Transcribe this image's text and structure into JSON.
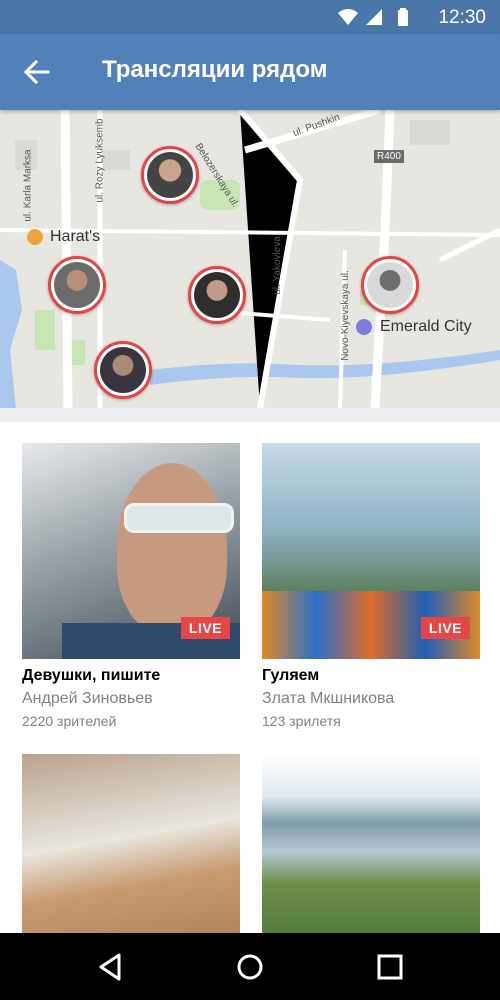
{
  "status_bar": {
    "time": "12:30"
  },
  "app_bar": {
    "title": "Трансляции рядом",
    "back_icon": "arrow-left-icon"
  },
  "map": {
    "streets": [
      "ul. Pushkin",
      "Belozerskaya ul.",
      "ul. Karla Marksa",
      "ul. Rozy Lyuksemb",
      "ul. Yakovleva",
      "Novo-Kiyevskaya ul.",
      "R400"
    ],
    "places": [
      {
        "name": "Harat's",
        "icon": "restaurant-icon",
        "color": "#f0a43c"
      },
      {
        "name": "Emerald City",
        "icon": "shopping-icon",
        "color": "#7b7ce0"
      }
    ]
  },
  "streams": [
    {
      "title": "Девушки, пишите",
      "author": "Андрей Зиновьев",
      "viewers": "2220 зрителей",
      "badge": "LIVE"
    },
    {
      "title": "Гуляем",
      "author": "Злата Мкшникова",
      "viewers": "123 зрилетя",
      "badge": "LIVE"
    },
    {
      "title": "",
      "author": "",
      "viewers": "",
      "badge": ""
    },
    {
      "title": "",
      "author": "",
      "viewers": "",
      "badge": ""
    }
  ],
  "colors": {
    "header": "#5181b8",
    "statusbar": "#4a76a8",
    "live": "#e64646",
    "marker_ring": "#e24545"
  },
  "nav": {
    "back": "triangle-back-icon",
    "home": "circle-home-icon",
    "recents": "square-recents-icon"
  }
}
